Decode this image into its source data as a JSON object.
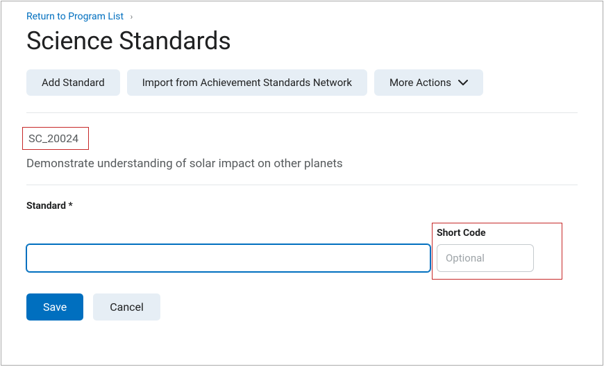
{
  "breadcrumb": {
    "return_label": "Return to Program List"
  },
  "page": {
    "title": "Science Standards"
  },
  "actions": {
    "add_standard": "Add Standard",
    "import_asn": "Import from Achievement Standards Network",
    "more_actions": "More Actions"
  },
  "current_standard": {
    "short_code": "SC_20024",
    "description": "Demonstrate understanding of solar impact on other planets"
  },
  "form": {
    "standard_label": "Standard *",
    "standard_value": "",
    "short_code_label": "Short Code",
    "short_code_value": "",
    "short_code_placeholder": "Optional",
    "save_label": "Save",
    "cancel_label": "Cancel"
  }
}
